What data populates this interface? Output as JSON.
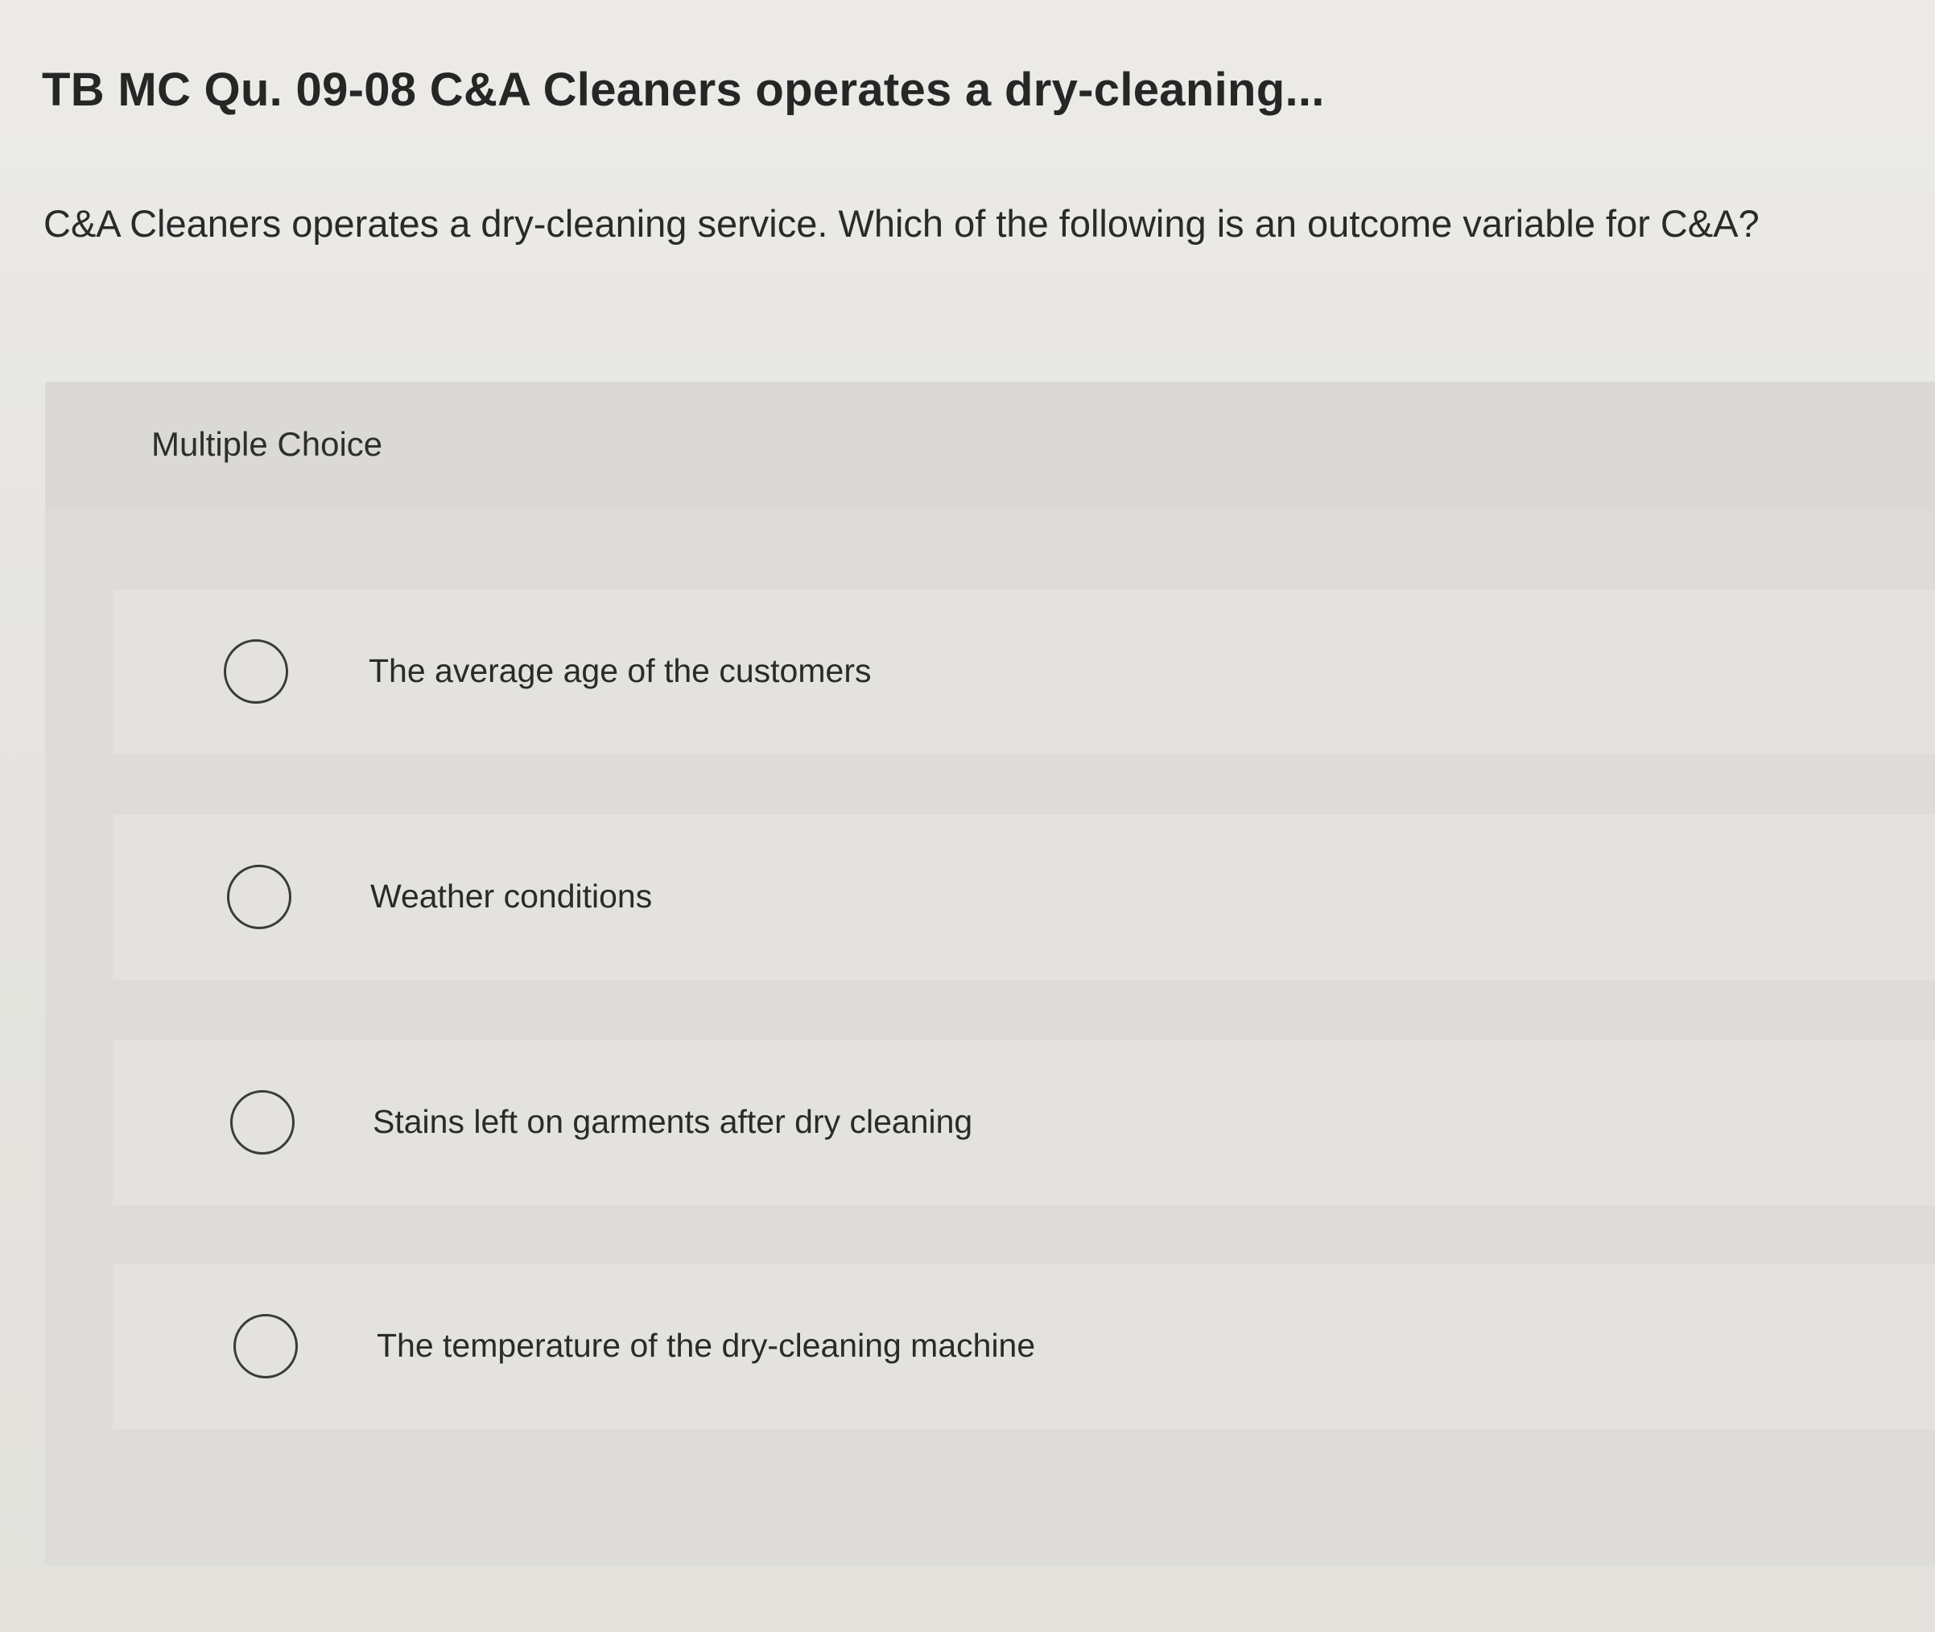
{
  "title": "TB MC Qu. 09-08 C&A Cleaners operates a dry-cleaning...",
  "question": "C&A Cleaners operates a dry-cleaning service. Which of the following is an outcome variable for C&A?",
  "multiple_choice": {
    "label": "Multiple Choice",
    "options": [
      {
        "label": "The average age of the customers",
        "selected": false
      },
      {
        "label": "Weather conditions",
        "selected": false
      },
      {
        "label": "Stains left on garments after dry cleaning",
        "selected": false
      },
      {
        "label": "The temperature of the dry-cleaning machine",
        "selected": false
      }
    ]
  }
}
